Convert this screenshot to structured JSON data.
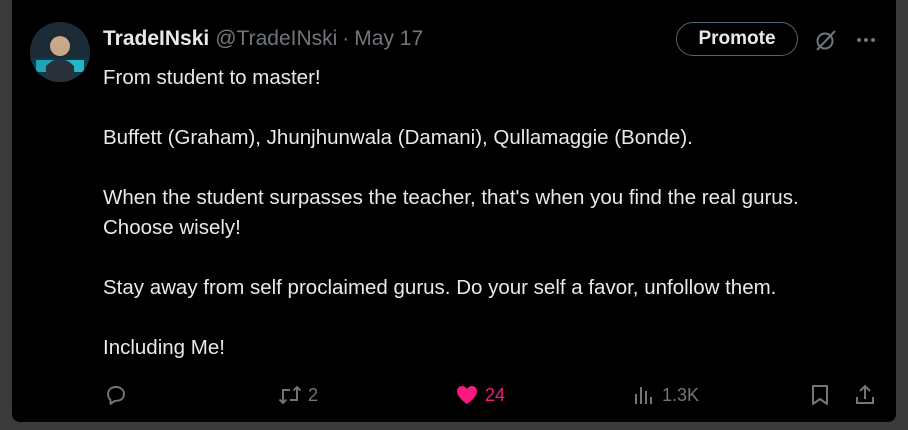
{
  "tweet": {
    "display_name": "TradeINski",
    "handle": "@TradeINski",
    "separator": "·",
    "date": "May 17",
    "promote_label": "Promote",
    "body_lines": [
      "From student to master!",
      "Buffett (Graham), Jhunjhunwala (Damani), Qullamaggie (Bonde).",
      "When the student surpasses the teacher, that's when you find the real gurus. Choose wisely!",
      "Stay away from self proclaimed gurus. Do your self a favor, unfollow them.",
      "Including Me!"
    ],
    "actions": {
      "reply_icon": "reply-icon",
      "retweet_icon": "retweet-icon",
      "retweet_count": "2",
      "like_icon": "heart-filled-icon",
      "like_count": "24",
      "views_icon": "analytics-icon",
      "views_count": "1.3K",
      "bookmark_icon": "bookmark-icon",
      "share_icon": "share-icon"
    }
  },
  "colors": {
    "background": "#000000",
    "text": "#e7e9ea",
    "muted": "#71767b",
    "like": "#f91880",
    "border": "#536471"
  }
}
